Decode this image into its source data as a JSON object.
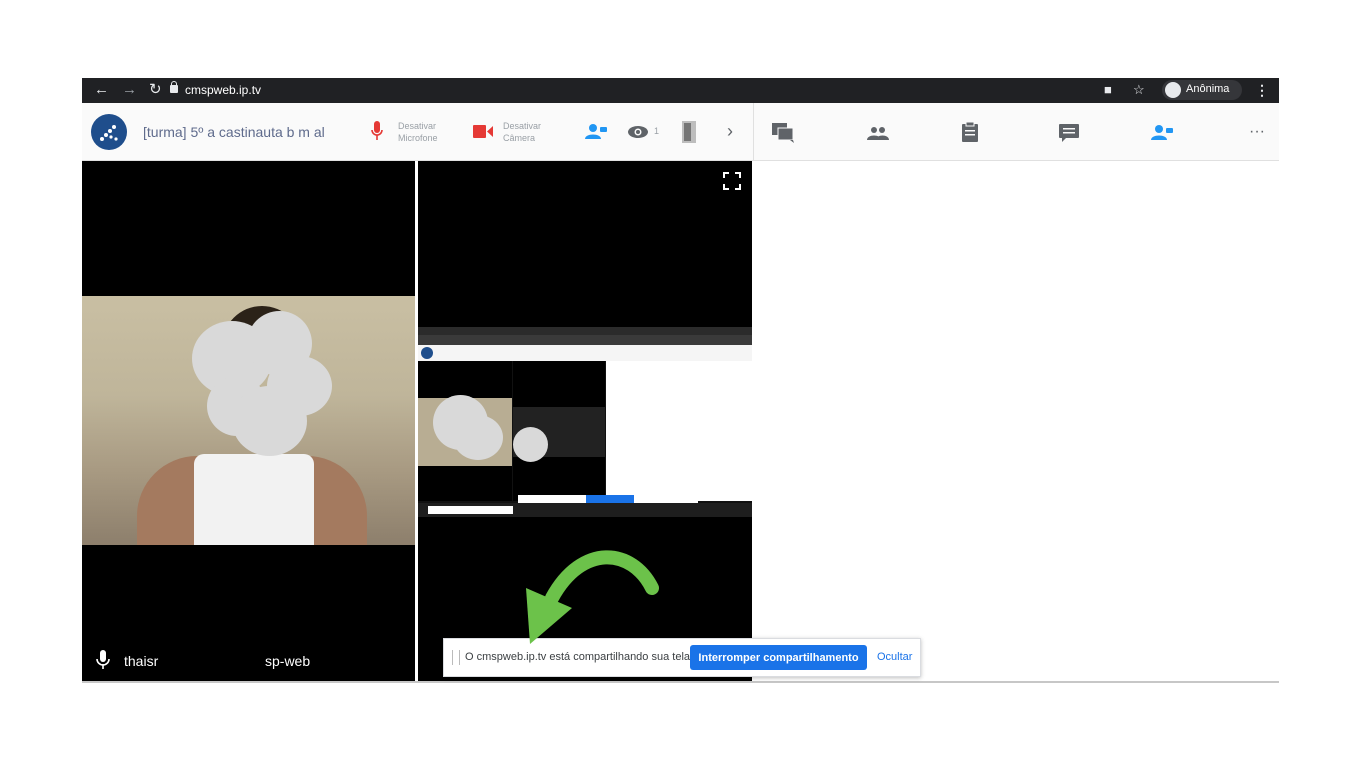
{
  "browser": {
    "url": "cmspweb.ip.tv",
    "profile_label": "Anônima"
  },
  "toolbar": {
    "room_title": "[turma] 5º a castinauta b m al",
    "mic_label_1": "Desativar",
    "mic_label_2": "Microfone",
    "cam_label_1": "Desativar",
    "cam_label_2": "Câmera",
    "viewers_count": "1"
  },
  "videos": {
    "left_tile_name_start": "thaisr",
    "left_tile_name_end": "sp-web"
  },
  "share_bar": {
    "message": "O cmspweb.ip.tv está compartilhando sua tela.",
    "stop_button": "Interromper compartilhamento",
    "hide_link": "Ocultar"
  },
  "colors": {
    "accent": "#1a73e8",
    "alert_red": "#e53935",
    "cyan": "#2196f3",
    "arrow_green": "#6cc24a"
  }
}
